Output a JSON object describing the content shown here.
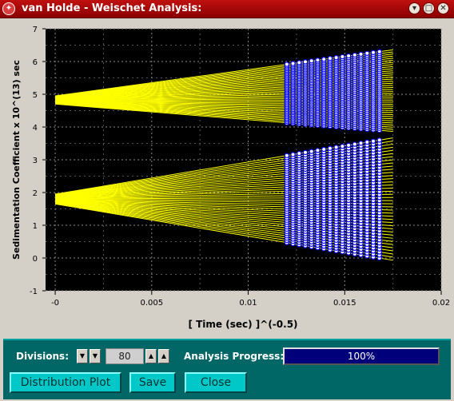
{
  "window": {
    "title": "van Holde - Weischet Analysis:"
  },
  "colors": {
    "plot_bg": "#000000",
    "fit_lines": "#ffff00",
    "data_points": "#0000ff",
    "data_points_fill": "#ffffff",
    "panel_bg": "#006666",
    "button_bg": "#00c8c8",
    "progress_fill": "#00007a"
  },
  "icons": {
    "app": "app-icon",
    "window_buttons": [
      "minimize-icon",
      "maximize-icon",
      "close-icon"
    ]
  },
  "chart_data": {
    "type": "scatter",
    "xlabel": "[ Time (sec) ]^(-0.5)",
    "ylabel": "Sedimentation Coefficient x 10^(13) sec",
    "xlim": [
      -0.0005,
      0.02
    ],
    "ylim": [
      -1,
      7
    ],
    "xticks": [
      "-0",
      "0.005",
      "0.01",
      "0.015",
      "0.02"
    ],
    "yticks": [
      "-1",
      "0",
      "1",
      "2",
      "3",
      "4",
      "5",
      "6",
      "7"
    ],
    "grid": true,
    "scan_x_range": [
      0.012,
      0.0168
    ],
    "scan_count": 16,
    "fit_line_x_range": [
      0,
      0.0175
    ],
    "boundary_groups": [
      {
        "intercept_low": 4.7,
        "intercept_high": 4.95,
        "value_low_at_last_scan": 3.9,
        "value_high_at_last_scan": 6.3,
        "boundary_divisions": 40
      },
      {
        "intercept_low": 1.65,
        "intercept_high": 1.95,
        "value_low_at_last_scan": 0.0,
        "value_high_at_last_scan": 3.6,
        "boundary_divisions": 40
      }
    ]
  },
  "controls": {
    "divisions_label": "Divisions:",
    "divisions_value": "80",
    "progress_label": "Analysis Progress:",
    "progress_value": 1.0,
    "progress_text": "100%",
    "distribution_button": "Distribution Plot",
    "save_button": "Save",
    "close_button": "Close"
  }
}
